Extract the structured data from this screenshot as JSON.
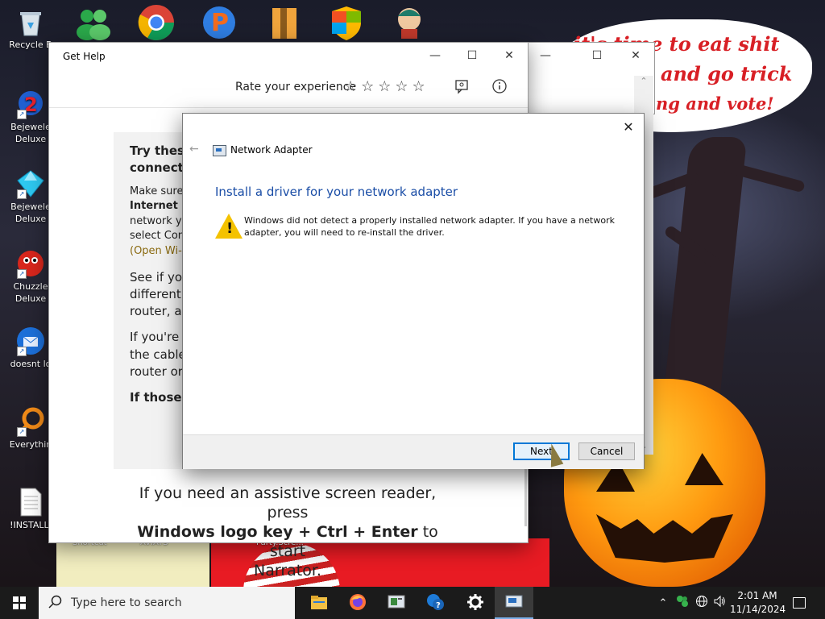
{
  "desktop": {
    "wallpaper_text": [
      "it's time to eat shit",
      "and go trick",
      "ng and vote!"
    ],
    "icons": [
      {
        "label": "Recycle B",
        "icon": "recycle-bin-icon"
      },
      {
        "label": "Bejewele\nDeluxe",
        "icon": "bejeweled-2-icon"
      },
      {
        "label": "Bejewele\nDeluxe",
        "icon": "bejeweled-icon"
      },
      {
        "label": "Chuzzle\nDeluxe",
        "icon": "chuzzle-icon"
      },
      {
        "label": "doesnt lo",
        "icon": "thunderbird-icon"
      },
      {
        "label": "Everythin",
        "icon": "everything-search-icon"
      },
      {
        "label": "!INSTALLI",
        "icon": "document-icon"
      }
    ],
    "partial_labels": [
      "Shortcut",
      "AVIATS",
      "Party.Scre..."
    ]
  },
  "get_help": {
    "title": "Get Help",
    "rate_label": "Rate your experience",
    "stars": "☆☆☆☆☆",
    "card_title_1": "Try these",
    "card_title_2": "connecti",
    "para1": [
      "Make sure",
      "Internet >",
      "network yo",
      "select Conn",
      "(Open Wi-F"
    ],
    "para2": [
      "See if you",
      "different c",
      "router, an"
    ],
    "para3": [
      "If you're u",
      "the cable",
      "router or"
    ],
    "para4": "If those d",
    "narrator_1": "If you need an assistive screen reader, press",
    "narrator_bold": "Windows logo key + Ctrl + Enter",
    "narrator_2": "to start",
    "narrator_3": "Narrator."
  },
  "dialog": {
    "app_title": "Network Adapter",
    "heading": "Install a driver for your network adapter",
    "message": "Windows did not detect a properly installed network adapter. If you have a network adapter, you will need to re-install the driver.",
    "next_label": "Next",
    "cancel_label": "Cancel"
  },
  "taskbar": {
    "search_placeholder": "Type here to search",
    "time": "2:01 AM",
    "date": "11/14/2024",
    "pinned_apps": [
      "file-explorer-icon",
      "firefox-icon",
      "network-app-icon",
      "get-help-icon",
      "settings-icon",
      "network-adapter-icon"
    ]
  },
  "colors": {
    "accent": "#0078d7",
    "heading_blue": "#1a4da6",
    "warning": "#f4c200",
    "wallpaper_text": "#d81f25"
  }
}
